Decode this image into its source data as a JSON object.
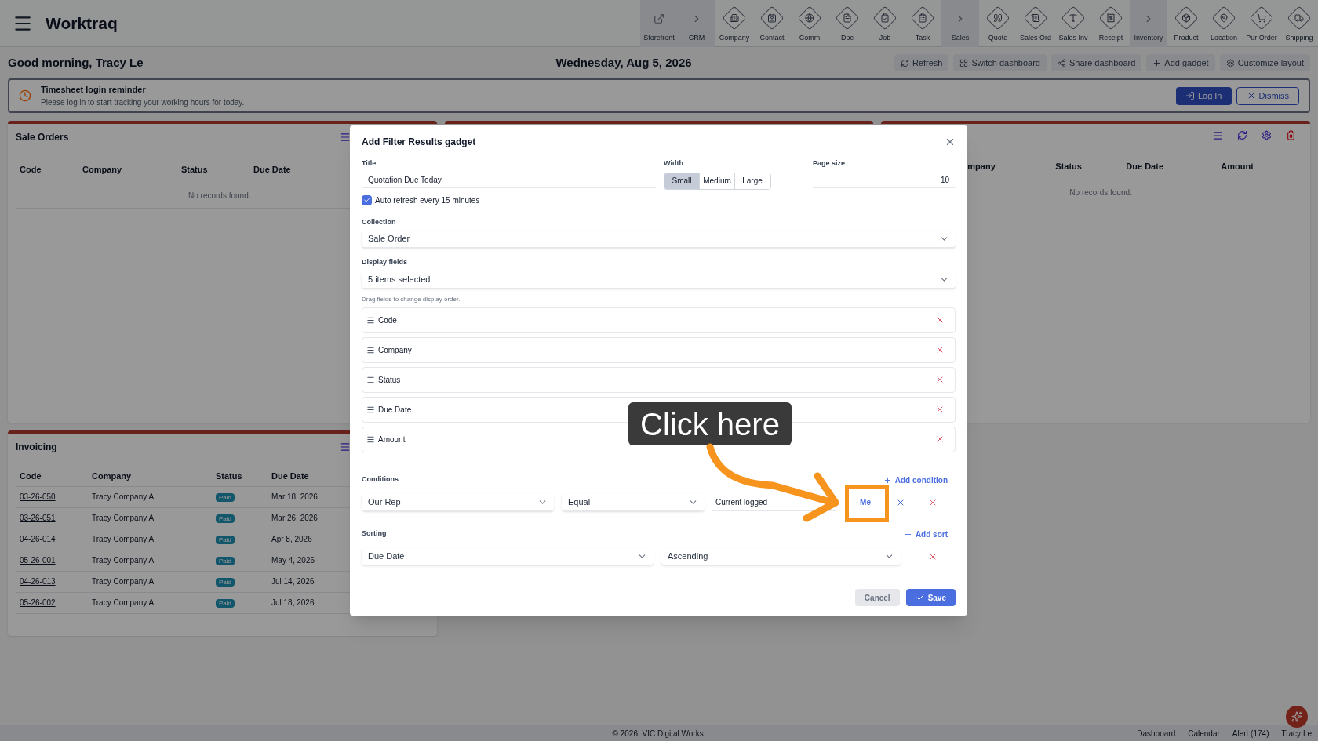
{
  "app": {
    "title": "Worktraq"
  },
  "nav": [
    {
      "label": "Storefront",
      "kind": "group"
    },
    {
      "label": "CRM",
      "kind": "group"
    },
    {
      "label": "Company",
      "kind": "module"
    },
    {
      "label": "Contact",
      "kind": "module"
    },
    {
      "label": "Comm",
      "kind": "module"
    },
    {
      "label": "Doc",
      "kind": "module"
    },
    {
      "label": "Job",
      "kind": "module"
    },
    {
      "label": "Task",
      "kind": "module"
    },
    {
      "label": "Sales",
      "kind": "group"
    },
    {
      "label": "Quote",
      "kind": "module"
    },
    {
      "label": "Sales Ord",
      "kind": "module"
    },
    {
      "label": "Sales Inv",
      "kind": "module"
    },
    {
      "label": "Receipt",
      "kind": "module"
    },
    {
      "label": "Inventory",
      "kind": "group"
    },
    {
      "label": "Product",
      "kind": "module"
    },
    {
      "label": "Location",
      "kind": "module"
    },
    {
      "label": "Pur Order",
      "kind": "module"
    },
    {
      "label": "Shipping",
      "kind": "module"
    }
  ],
  "greeting": "Good morning, Tracy Le",
  "date": "Wednesday, Aug 5, 2026",
  "toolbar": [
    "Refresh",
    "Switch dashboard",
    "Share dashboard",
    "Add gadget",
    "Customize layout"
  ],
  "reminder": {
    "title": "Timesheet login reminder",
    "text": "Please log in to start tracking your working hours for today.",
    "buttons": [
      "Log In",
      "Dismiss"
    ]
  },
  "sale_orders": {
    "title": "Sale Orders",
    "columns": [
      "Code",
      "Company",
      "Status",
      "Due Date"
    ],
    "empty": "No records found."
  },
  "right_panel": {
    "columns": [
      "mpany",
      "Status",
      "Due Date",
      "Amount"
    ],
    "empty": "No records found."
  },
  "invoicing": {
    "title": "Invoicing",
    "columns": [
      "Code",
      "Company",
      "Status",
      "Due Date"
    ],
    "rows": [
      {
        "code": "03-26-050",
        "company": "Tracy Company A",
        "status": "Paid",
        "due": "Mar 18, 2026"
      },
      {
        "code": "03-26-051",
        "company": "Tracy Company A",
        "status": "Paid",
        "due": "Mar 26, 2026"
      },
      {
        "code": "04-26-014",
        "company": "Tracy Company A",
        "status": "Paid",
        "due": "Apr 8, 2026"
      },
      {
        "code": "05-26-001",
        "company": "Tracy Company A",
        "status": "Paid",
        "due": "May 4, 2026"
      },
      {
        "code": "04-26-013",
        "company": "Tracy Company A",
        "status": "Paid",
        "due": "Jul 14, 2026"
      },
      {
        "code": "05-26-002",
        "company": "Tracy Company A",
        "status": "Paid",
        "due": "Jul 18, 2026"
      }
    ]
  },
  "dialog": {
    "title": "Add Filter Results gadget",
    "title_field": {
      "label": "Title",
      "value": "Quotation Due Today"
    },
    "width": {
      "label": "Width",
      "options": [
        {
          "label": "Small",
          "selected": true
        },
        {
          "label": "Medium",
          "selected": false
        },
        {
          "label": "Large",
          "selected": false
        }
      ]
    },
    "page_size": {
      "label": "Page size",
      "value": "10"
    },
    "auto_refresh": {
      "label": "Auto refresh every 15 minutes",
      "checked": true
    },
    "collection": {
      "label": "Collection",
      "value": "Sale Order"
    },
    "display_fields": {
      "label": "Display fields",
      "value": "5 items selected",
      "hint": "Drag fields to change display order.",
      "items": [
        "Code",
        "Company",
        "Status",
        "Due Date",
        "Amount"
      ]
    },
    "conditions": {
      "label": "Conditions",
      "add": "Add condition",
      "field": "Our Rep",
      "operator": "Equal",
      "value": "Current logged",
      "me": "Me"
    },
    "sorting": {
      "label": "Sorting",
      "add": "Add sort",
      "field": "Due Date",
      "order": "Ascending"
    },
    "buttons": [
      "Cancel",
      "Save"
    ]
  },
  "callout": "Click here",
  "footer": {
    "copyright": "© 2026, VIC Digital Works.",
    "links": [
      "Dashboard",
      "Calendar",
      "Alert (174)",
      "Tracy Le"
    ]
  }
}
